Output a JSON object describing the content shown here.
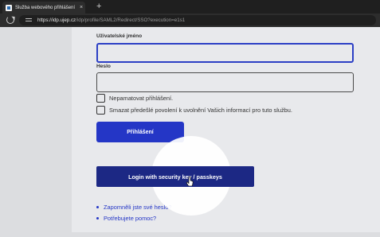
{
  "browser": {
    "tab_title": "Služba webového přihlášení",
    "tab_close": "×",
    "new_tab": "+",
    "url_host": "https://idp.ujep.cz",
    "url_path": "/idp/profile/SAML2/Redirect/SSO?execution=e1s1"
  },
  "form": {
    "username_label": "Uživatelské jméno",
    "password_label": "Heslo",
    "remember_label": "Nepamatovat přihlášení.",
    "revoke_label": "Smazat předešlé povolení k uvolnění Vašich informací pro tuto službu.",
    "login_button": "Přihlášení",
    "passkey_button": "Login with security key / passkeys"
  },
  "links": [
    {
      "label": "Zapomněli jste své heslo?"
    },
    {
      "label": "Potřebujete pomoc?"
    }
  ],
  "colors": {
    "primary": "#2436c6",
    "passkey": "#1c2884",
    "focus_border": "#2c3fc5"
  }
}
